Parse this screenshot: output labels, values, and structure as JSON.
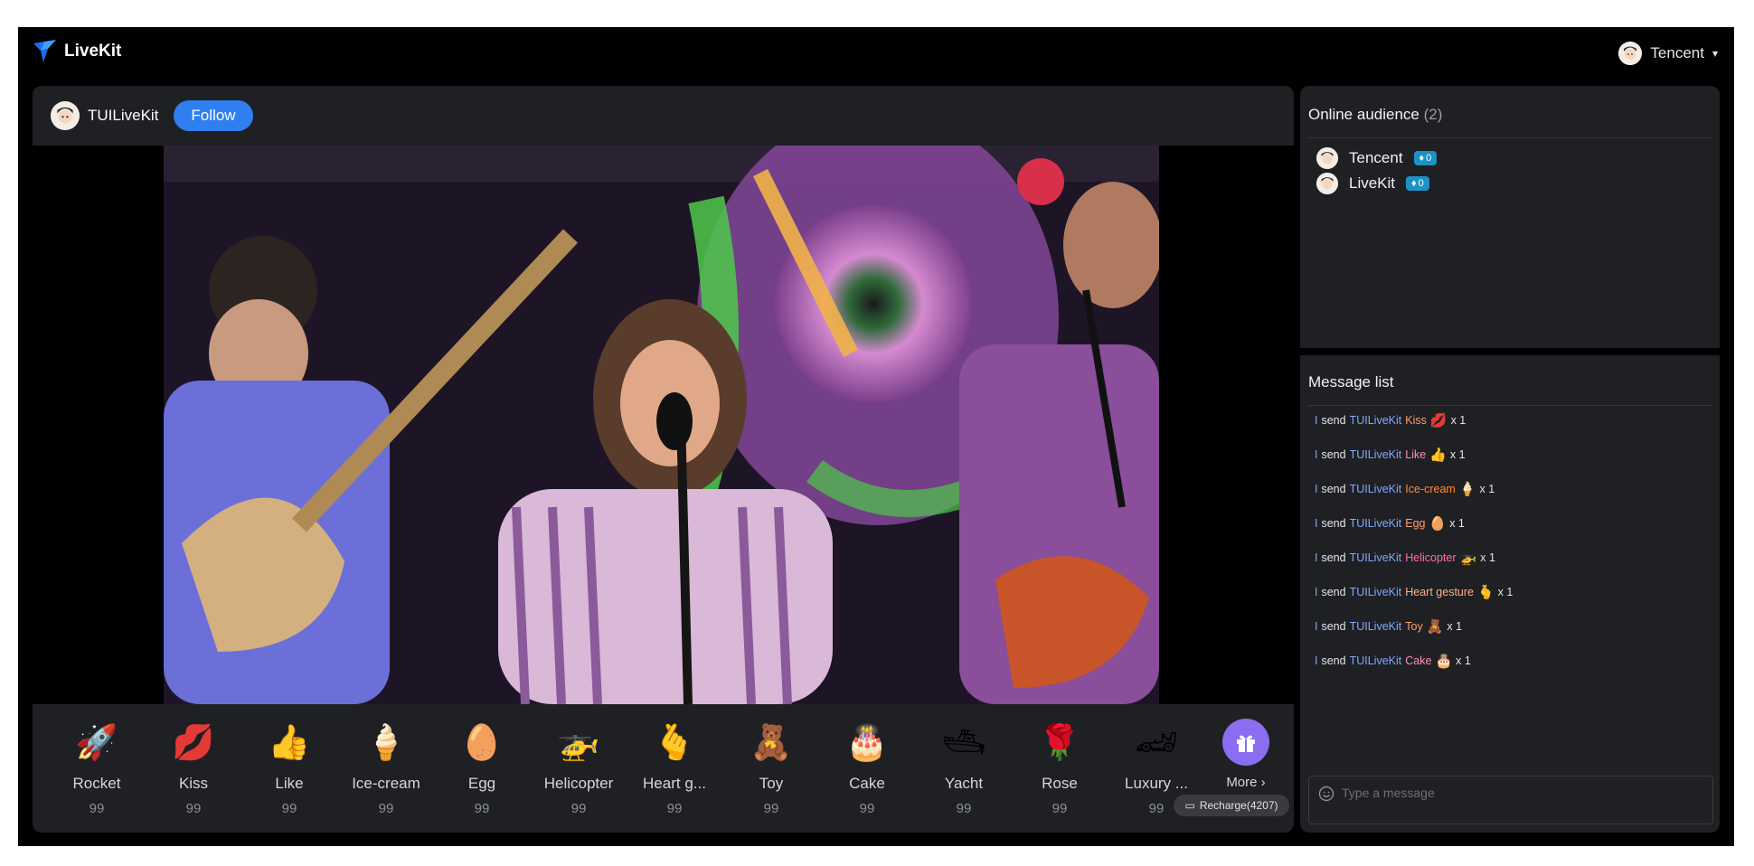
{
  "app": {
    "title": "LiveKit"
  },
  "user_menu": {
    "name": "Tencent"
  },
  "anchor": {
    "name": "TUILiveKit",
    "follow_label": "Follow"
  },
  "gifts": [
    {
      "name": "Rocket",
      "price": "99",
      "icon": "rocket-icon",
      "glyph": "🚀"
    },
    {
      "name": "Kiss",
      "price": "99",
      "icon": "kiss-icon",
      "glyph": "💋"
    },
    {
      "name": "Like",
      "price": "99",
      "icon": "thumbs-up-icon",
      "glyph": "👍"
    },
    {
      "name": "Ice-cream",
      "price": "99",
      "icon": "ice-cream-icon",
      "glyph": "🍦"
    },
    {
      "name": "Egg",
      "price": "99",
      "icon": "egg-icon",
      "glyph": "🥚"
    },
    {
      "name": "Helicopter",
      "price": "99",
      "icon": "helicopter-icon",
      "glyph": "🚁"
    },
    {
      "name": "Heart g...",
      "price": "99",
      "icon": "heart-gesture-icon",
      "glyph": "🫰"
    },
    {
      "name": "Toy",
      "price": "99",
      "icon": "toy-bear-icon",
      "glyph": "🧸"
    },
    {
      "name": "Cake",
      "price": "99",
      "icon": "cake-icon",
      "glyph": "🎂"
    },
    {
      "name": "Yacht",
      "price": "99",
      "icon": "yacht-icon",
      "glyph": "🛥"
    },
    {
      "name": "Rose",
      "price": "99",
      "icon": "rose-icon",
      "glyph": "🌹"
    },
    {
      "name": "Luxury ...",
      "price": "99",
      "icon": "sports-car-icon",
      "glyph": "🏎"
    }
  ],
  "more": {
    "label": "More",
    "recharge_label": "Recharge(4207)"
  },
  "audience": {
    "title": "Online audience",
    "count": "(2)",
    "members": [
      {
        "name": "Tencent",
        "level": "0"
      },
      {
        "name": "LiveKit",
        "level": "0"
      }
    ]
  },
  "messages": {
    "title": "Message list",
    "items": [
      {
        "i": "I",
        "verb": "send",
        "to": "TUILiveKit",
        "gift": "Kiss",
        "glyph": "💋",
        "count": "x 1",
        "color": "#ff9f6b"
      },
      {
        "i": "I",
        "verb": "send",
        "to": "TUILiveKit",
        "gift": "Like",
        "glyph": "👍",
        "count": "x 1",
        "color": "#ff8fb0"
      },
      {
        "i": "I",
        "verb": "send",
        "to": "TUILiveKit",
        "gift": "Ice-cream",
        "glyph": "🍦",
        "count": "x 1",
        "color": "#ff8a3d"
      },
      {
        "i": "I",
        "verb": "send",
        "to": "TUILiveKit",
        "gift": "Egg",
        "glyph": "🥚",
        "count": "x 1",
        "color": "#ff9f6b"
      },
      {
        "i": "I",
        "verb": "send",
        "to": "TUILiveKit",
        "gift": "Helicopter",
        "glyph": "🚁",
        "count": "x 1",
        "color": "#ff6fa0"
      },
      {
        "i": "I",
        "verb": "send",
        "to": "TUILiveKit",
        "gift": "Heart gesture",
        "glyph": "🫰",
        "count": "x 1",
        "color": "#ffb08a"
      },
      {
        "i": "I",
        "verb": "send",
        "to": "TUILiveKit",
        "gift": "Toy",
        "glyph": "🧸",
        "count": "x 1",
        "color": "#ff9f6b"
      },
      {
        "i": "I",
        "verb": "send",
        "to": "TUILiveKit",
        "gift": "Cake",
        "glyph": "🎂",
        "count": "x 1",
        "color": "#ff8fb0"
      }
    ],
    "input_placeholder": "Type a message"
  },
  "colors": {
    "follow": "#2f7ff0",
    "more_gift": "#8a6df0",
    "badge": "#1b93c4",
    "panel_bg": "#1f2024"
  }
}
